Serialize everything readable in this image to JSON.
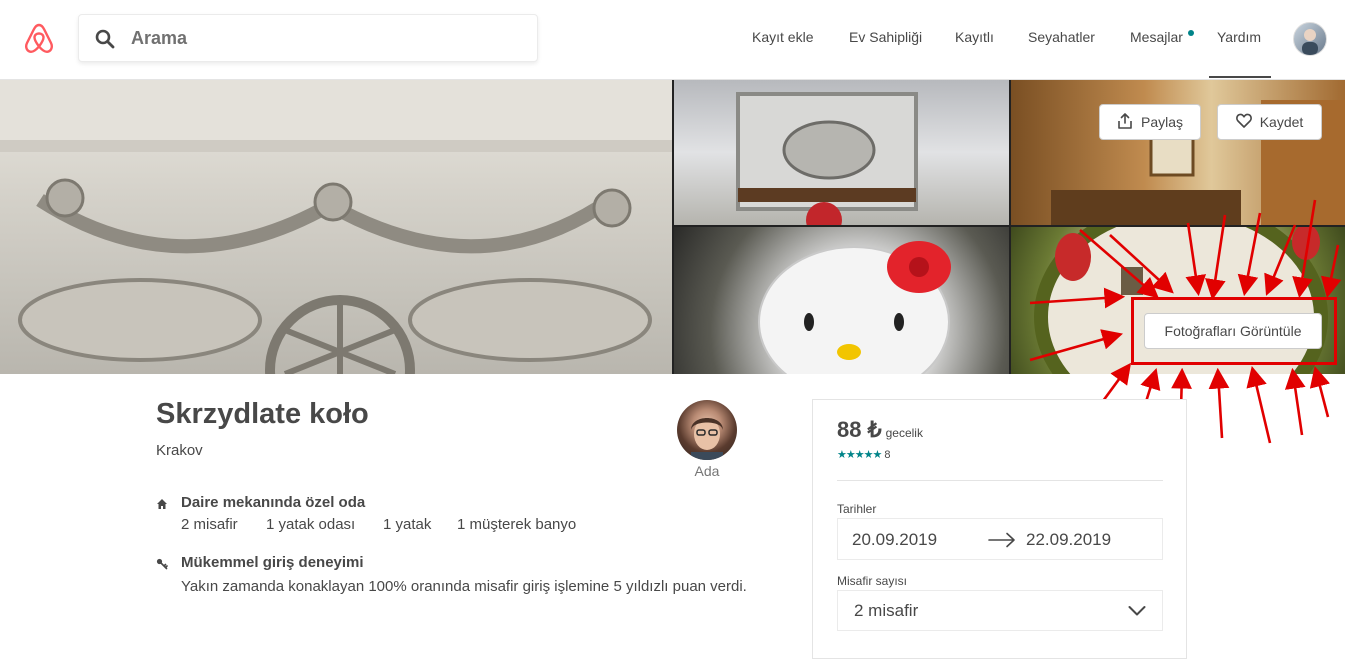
{
  "header": {
    "logo_icon": "airbnb-belo-icon",
    "search": {
      "placeholder": "Arama",
      "icon": "search-icon"
    },
    "nav": [
      "Kayıt ekle",
      "Ev Sahipliği",
      "Kayıtlı",
      "Seyahatler",
      "Mesajlar",
      "Yardım"
    ],
    "messages_has_notification": true,
    "active_nav": "Yardım",
    "accent_color": "#FF5A5F",
    "notification_color": "#008489"
  },
  "gallery": {
    "share_label": "Paylaş",
    "save_label": "Kaydet",
    "view_photos_label": "Fotoğrafları Görüntüle",
    "share_icon": "share-icon",
    "save_icon": "heart-icon",
    "annotation_color": "#E10000"
  },
  "listing": {
    "title": "Skrzydlate koło",
    "location": "Krakov",
    "host_name": "Ada",
    "features": [
      {
        "icon": "home-icon",
        "title": "Daire mekanında özel oda",
        "details": [
          "2 misafir",
          "1 yatak odası",
          "1 yatak",
          "1 müşterek banyo"
        ]
      },
      {
        "icon": "key-icon",
        "title": "Mükemmel giriş deneyimi",
        "description": "Yakın zamanda konaklayan 100% oranında misafir giriş işlemine 5 yıldızlı puan verdi."
      }
    ]
  },
  "booking": {
    "price": "88 ₺",
    "per_night": "gecelik",
    "stars": "★★★★★",
    "reviews_count": "8",
    "dates_label": "Tarihler",
    "check_in": "20.09.2019",
    "check_out": "22.09.2019",
    "guests_label": "Misafir sayısı",
    "guests_value": "2 misafir",
    "star_color": "#008489"
  }
}
